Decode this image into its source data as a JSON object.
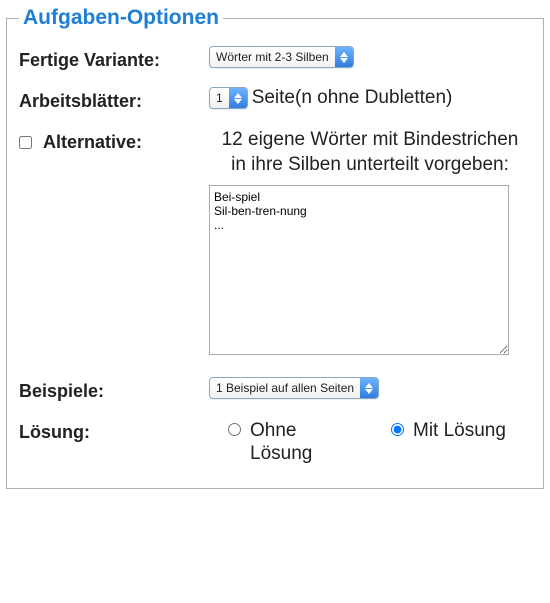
{
  "panel": {
    "legend": "Aufgaben-Optionen"
  },
  "variant": {
    "label": "Fertige Variante:",
    "selected": "Wörter mit 2-3 Silben"
  },
  "worksheets": {
    "label": "Arbeitsblätter:",
    "count_selected": "1",
    "suffix": "Seite(n ohne Dubletten)"
  },
  "alternative": {
    "label": "Alternative:",
    "checked": false,
    "description_line1": "12 eigene Wörter mit Bindestrichen",
    "description_line2": "in ihre Silben unterteilt vorgeben:",
    "textarea_value": "Bei-spiel\nSil-ben-tren-nung\n..."
  },
  "examples": {
    "label": "Beispiele:",
    "selected": "1 Beispiel auf allen Seiten"
  },
  "solution": {
    "label": "Lösung:",
    "options": [
      {
        "label": "Ohne Lösung",
        "checked": false
      },
      {
        "label": "Mit Lösung",
        "checked": true
      }
    ]
  }
}
